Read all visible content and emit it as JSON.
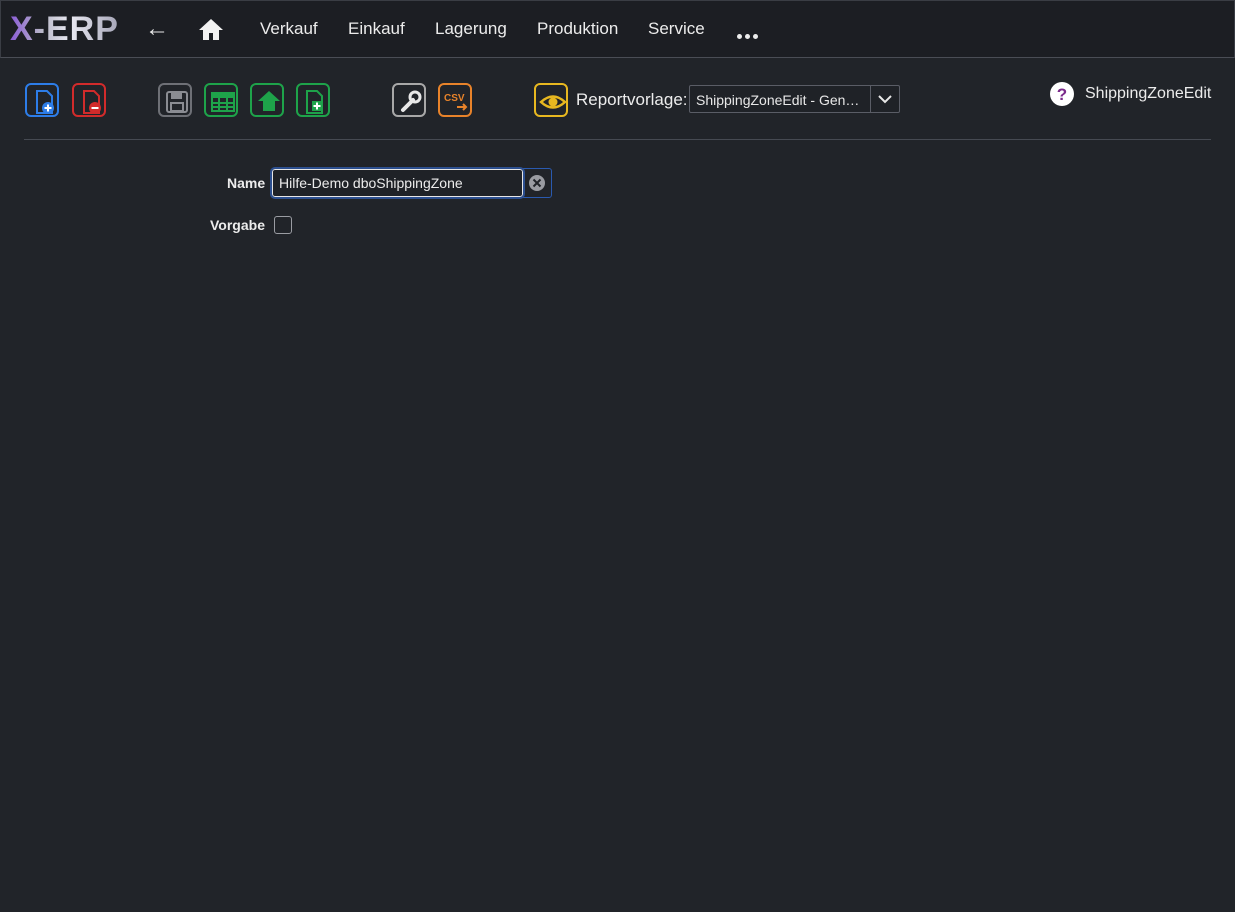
{
  "app": {
    "logo": "X-ERP"
  },
  "nav": {
    "back": "←",
    "items": [
      "Verkauf",
      "Einkauf",
      "Lagerung",
      "Produktion",
      "Service"
    ]
  },
  "toolbar": {
    "buttons": [
      {
        "name": "new-document",
        "color": "#2d7de8"
      },
      {
        "name": "delete-document",
        "color": "#d22b2b"
      },
      {
        "name": "save",
        "color": "#8a8c92"
      },
      {
        "name": "table-view",
        "color": "#1ea34a"
      },
      {
        "name": "upload",
        "color": "#1ea34a"
      },
      {
        "name": "add-document",
        "color": "#1ea34a"
      },
      {
        "name": "settings-wrench",
        "color": "#bdbdbd"
      },
      {
        "name": "csv-export",
        "color": "#e8832a",
        "text": "CSV"
      },
      {
        "name": "preview-eye",
        "color": "#e8b820"
      }
    ]
  },
  "report": {
    "label": "Reportvorlage:",
    "selected": "ShippingZoneEdit - Gen…"
  },
  "help": {
    "text": "ShippingZoneEdit"
  },
  "form": {
    "name_label": "Name",
    "name_value": "Hilfe-Demo dboShippingZone",
    "default_label": "Vorgabe",
    "default_checked": false
  }
}
